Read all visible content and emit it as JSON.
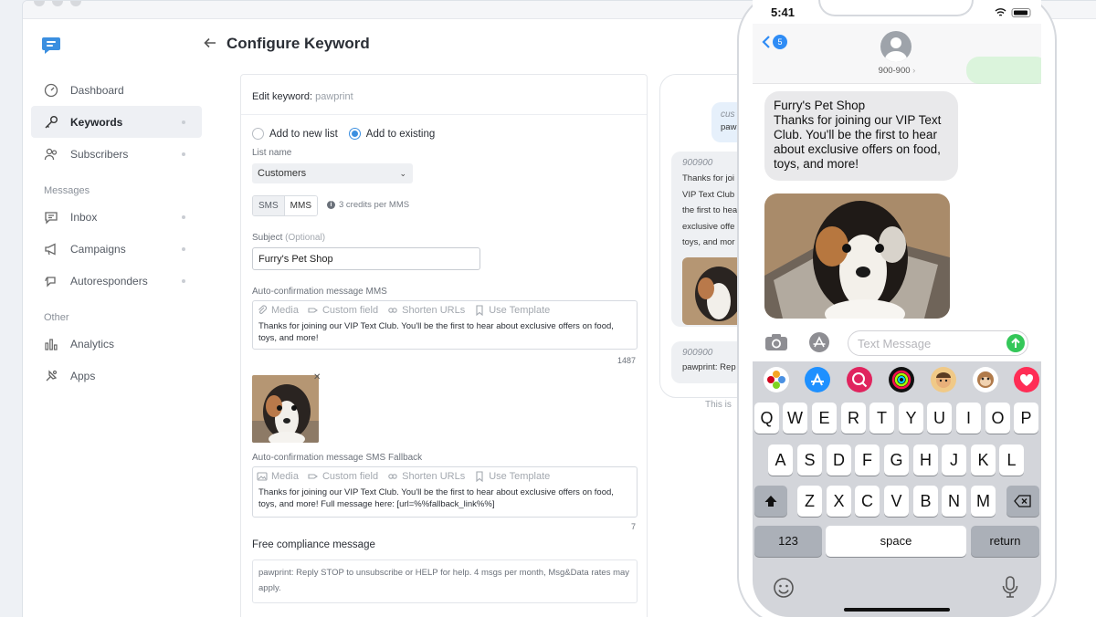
{
  "page": {
    "title": "Configure Keyword"
  },
  "sidebar": {
    "items": [
      {
        "label": "Dashboard",
        "icon": "dashboard-icon"
      },
      {
        "label": "Keywords",
        "icon": "key-icon",
        "active": true
      },
      {
        "label": "Subscribers",
        "icon": "users-icon"
      }
    ],
    "messages_section": "Messages",
    "message_items": [
      {
        "label": "Inbox",
        "icon": "inbox-icon"
      },
      {
        "label": "Campaigns",
        "icon": "megaphone-icon"
      },
      {
        "label": "Autoresponders",
        "icon": "autoresponder-icon"
      }
    ],
    "other_section": "Other",
    "other_items": [
      {
        "label": "Analytics",
        "icon": "bar-chart-icon"
      },
      {
        "label": "Apps",
        "icon": "puzzle-icon"
      }
    ]
  },
  "form": {
    "edit_label": "Edit keyword:",
    "keyword": "pawprint",
    "radio_new": "Add to new list",
    "radio_existing": "Add to existing",
    "list_name_label": "List name",
    "list_value": "Customers",
    "seg_sms": "SMS",
    "seg_mms": "MMS",
    "credits": "3 credits per MMS",
    "subject_label": "Subject",
    "subject_optional": "(Optional)",
    "subject_value": "Furry's Pet Shop",
    "mms_label": "Auto-confirmation message MMS",
    "toolbar": {
      "media": "Media",
      "custom_field": "Custom field",
      "shorten": "Shorten URLs",
      "template": "Use Template"
    },
    "mms_text": "Thanks for joining our VIP Text Club. You'll be the first to hear about exclusive offers on food, toys, and more!",
    "mms_count": "1487",
    "sms_label": "Auto-confirmation message SMS Fallback",
    "sms_text": "Thanks for joining our VIP Text Club. You'll be the first to hear about exclusive offers on food, toys, and more! Full message here: [url=%%fallback_link%%]",
    "sms_count": "7",
    "compliance_title": "Free compliance message",
    "compliance_text": "pawprint: Reply STOP to unsubscribe or HELP for help. 4 msgs per month, Msg&Data rates may apply."
  },
  "preview": {
    "top_bubble_l1": "cus",
    "top_bubble_l2": "paw",
    "num1": "900900",
    "body_lines": [
      "Thanks for joi",
      "VIP Text Club",
      "the first to hea",
      "exclusive offe",
      "toys, and mor"
    ],
    "num2": "900900",
    "reply": "pawprint: Rep",
    "note": "This is"
  },
  "phone": {
    "time": "5:41",
    "back_count": "5",
    "contact": "900-900",
    "sender": "Furry's Pet Shop",
    "message": "Thanks for joining our VIP Text Club. You'll be the first to hear about exclusive offers on food, toys, and more!",
    "placeholder": "Text Message",
    "keys_row1": [
      "Q",
      "W",
      "E",
      "R",
      "T",
      "Y",
      "U",
      "I",
      "O",
      "P"
    ],
    "keys_row2": [
      "A",
      "S",
      "D",
      "F",
      "G",
      "H",
      "J",
      "K",
      "L"
    ],
    "keys_row3": [
      "Z",
      "X",
      "C",
      "V",
      "B",
      "N",
      "M"
    ],
    "key_123": "123",
    "key_space": "space",
    "key_return": "return"
  },
  "colors": {
    "accent": "#3b8fe0",
    "ios_blue": "#2f8cf5",
    "ios_green": "#34c759",
    "brand": "#3b8fe0"
  }
}
